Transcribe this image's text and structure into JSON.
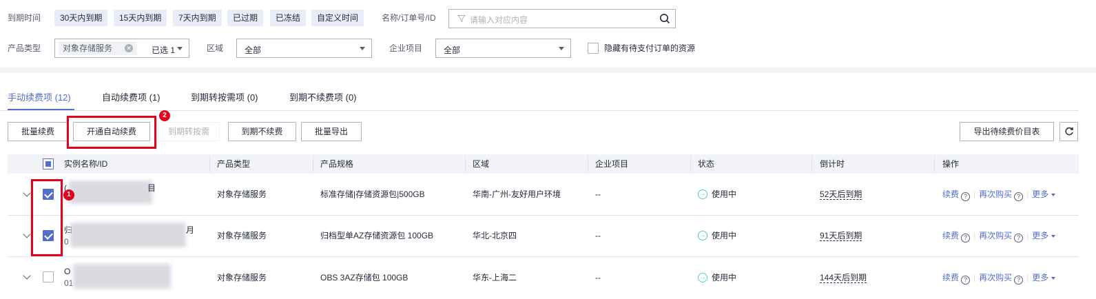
{
  "filters": {
    "expiry_label": "到期时间",
    "expiry_options": [
      "30天内到期",
      "15天内到期",
      "7天内到期",
      "已过期",
      "已冻结",
      "自定义时间"
    ],
    "search_label": "名称/订单号/ID",
    "search_placeholder": "请输入对应内容",
    "product_type_label": "产品类型",
    "product_type_tag": "对象存储服务",
    "product_type_selected": "已选 1",
    "region_label": "区域",
    "region_value": "全部",
    "enterprise_label": "企业项目",
    "enterprise_value": "全部",
    "hide_pending_label": "隐藏有待支付订单的资源"
  },
  "tabs": [
    {
      "label": "手动续费项 (12)",
      "active": true
    },
    {
      "label": "自动续费项 (1)",
      "active": false
    },
    {
      "label": "到期转按需项 (0)",
      "active": false
    },
    {
      "label": "到期不续费项 (0)",
      "active": false
    }
  ],
  "toolbar": {
    "batch_renew": "批量续费",
    "enable_auto_renew": "开通自动续费",
    "to_on_demand": "到期转按需",
    "no_renew": "到期不续费",
    "batch_export": "批量导出",
    "export_price_list": "导出待续费价目表"
  },
  "table": {
    "columns": [
      "实例名称/ID",
      "产品类型",
      "产品规格",
      "区域",
      "企业项目",
      "状态",
      "倒计时",
      "操作"
    ],
    "rows": [
      {
        "checked": true,
        "name_prefix": "(",
        "name_suffix": "目",
        "id_prefix": "",
        "product_type": "对象存储服务",
        "spec": "标准存储|存储资源包|500GB",
        "region": "华南-广州-友好用户环境",
        "enterprise": "--",
        "status": "使用中",
        "countdown": "52天后到期"
      },
      {
        "checked": true,
        "name_prefix": "归",
        "name_suffix": "月",
        "id_prefix": "0",
        "product_type": "对象存储服务",
        "spec": "归档型单AZ存储资源包 100GB",
        "region": "华北-北京四",
        "enterprise": "--",
        "status": "使用中",
        "countdown": "91天后到期"
      },
      {
        "checked": false,
        "name_prefix": "O",
        "name_suffix": "",
        "id_prefix": "01",
        "product_type": "对象存储服务",
        "spec": "OBS 3AZ存储包 100GB",
        "region": "华东-上海二",
        "enterprise": "--",
        "status": "使用中",
        "countdown": "144天后到期"
      }
    ],
    "actions": {
      "renew": "续费",
      "rebuy": "再次购买",
      "more": "更多"
    }
  },
  "annotations": {
    "badge_1": "1",
    "badge_2": "2"
  },
  "colors": {
    "accent": "#526ecc",
    "highlight": "#e6001e",
    "chip_bg": "#e8edf9",
    "status_green": "#50d4ab"
  }
}
